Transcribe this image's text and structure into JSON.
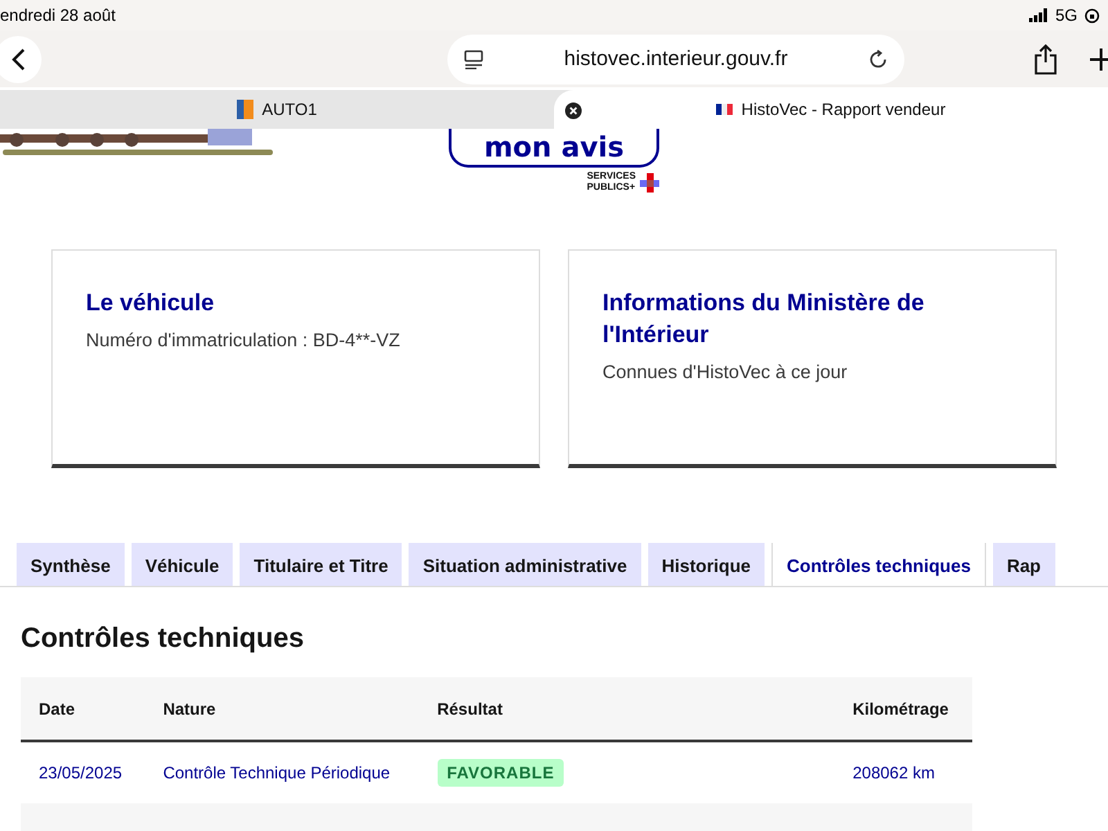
{
  "status_bar": {
    "date": "endredi 28 août",
    "network": "5G"
  },
  "browser": {
    "url": "histovec.interieur.gouv.fr",
    "tabs": [
      {
        "label": "AUTO1",
        "selected": false,
        "kind": "brand"
      },
      {
        "label": "HistoVec - Rapport vendeur",
        "selected": true,
        "kind": "flag"
      }
    ]
  },
  "header": {
    "feedback_button": "mon avis",
    "logo_lines": [
      "SERVICES",
      "PUBLICS+"
    ]
  },
  "cards": [
    {
      "title": "Le véhicule",
      "text": "Numéro d'immatriculation : BD-4**-VZ"
    },
    {
      "title": "Informations du Ministère de l'Intérieur",
      "text": "Connues d'HistoVec à ce jour"
    }
  ],
  "tabs": [
    {
      "label": "Synthèse",
      "selected": false
    },
    {
      "label": "Véhicule",
      "selected": false
    },
    {
      "label": "Titulaire et Titre",
      "selected": false
    },
    {
      "label": "Situation administrative",
      "selected": false
    },
    {
      "label": "Historique",
      "selected": false
    },
    {
      "label": "Contrôles techniques",
      "selected": true
    },
    {
      "label": "Rap",
      "selected": false
    }
  ],
  "section": {
    "title": "Contrôles techniques",
    "table": {
      "columns": [
        "Date",
        "Nature",
        "Résultat",
        "Kilométrage"
      ],
      "rows": [
        {
          "date": "23/05/2025",
          "nature": "Contrôle Technique Périodique",
          "result": "FAVORABLE",
          "favorable": true,
          "mileage": "208062 km"
        }
      ]
    }
  }
}
